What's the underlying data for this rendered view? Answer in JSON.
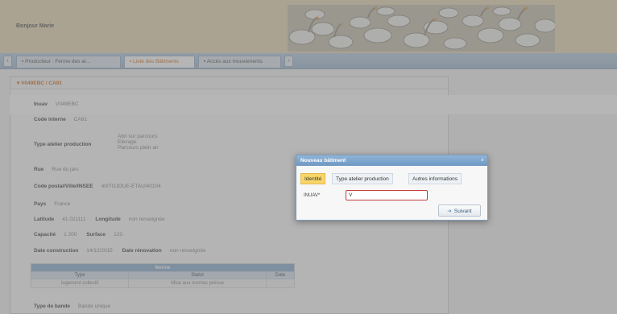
{
  "header": {
    "greeting": "Bonjour Marie"
  },
  "tabs": [
    {
      "label": "Producteur : Ferme des ar...",
      "active": false
    },
    {
      "label": "Liste des Bâtiments",
      "active": true
    },
    {
      "label": "Accès aux mouvements",
      "active": false
    }
  ],
  "panel": {
    "title": "V049EBC / CA91",
    "fields": {
      "inuav": {
        "label": "Inuav",
        "value": "V049EBC"
      },
      "code_interne": {
        "label": "Code interne",
        "value": "CA91"
      },
      "type_atelier": {
        "label": "Type atelier production",
        "values": [
          "Abri sur parcours",
          "Elevage",
          "Parcours plein air"
        ]
      },
      "rue": {
        "label": "Rue",
        "value": "Rue du jars"
      },
      "code_postal": {
        "label": "Code postal/Ville/INSEE",
        "value": "40/TOJOUE-ETAU/40104"
      },
      "pays": {
        "label": "Pays",
        "value": "France"
      },
      "latitude": {
        "label": "Latitude",
        "value": "41.021111"
      },
      "longitude": {
        "label": "Longitude",
        "value": "non renseignée"
      },
      "capacite": {
        "label": "Capacité",
        "value": "1 200"
      },
      "surface": {
        "label": "Surface",
        "value": "123"
      },
      "date_construction": {
        "label": "Date construction",
        "value": "14/12/2015"
      },
      "date_renovation": {
        "label": "Date rénovation",
        "value": "non renseignée"
      },
      "type_bande": {
        "label": "Type de bande",
        "value": "Bande unique"
      }
    },
    "table": {
      "caption": "Norme",
      "headers": [
        "Type",
        "Statut",
        "Date"
      ],
      "rows": [
        {
          "type": "logement collectif",
          "statut": "Mise aux normes prévue",
          "date": ""
        }
      ]
    }
  },
  "dialog": {
    "title": "Nouveau bâtiment",
    "close_glyph": "×",
    "tabs": [
      "Identité",
      "Type atelier production",
      "Autres informations"
    ],
    "field_label": "INUAV*",
    "field_value": "V",
    "next_label": "Suivant",
    "next_icon": "arrow-right-icon"
  }
}
